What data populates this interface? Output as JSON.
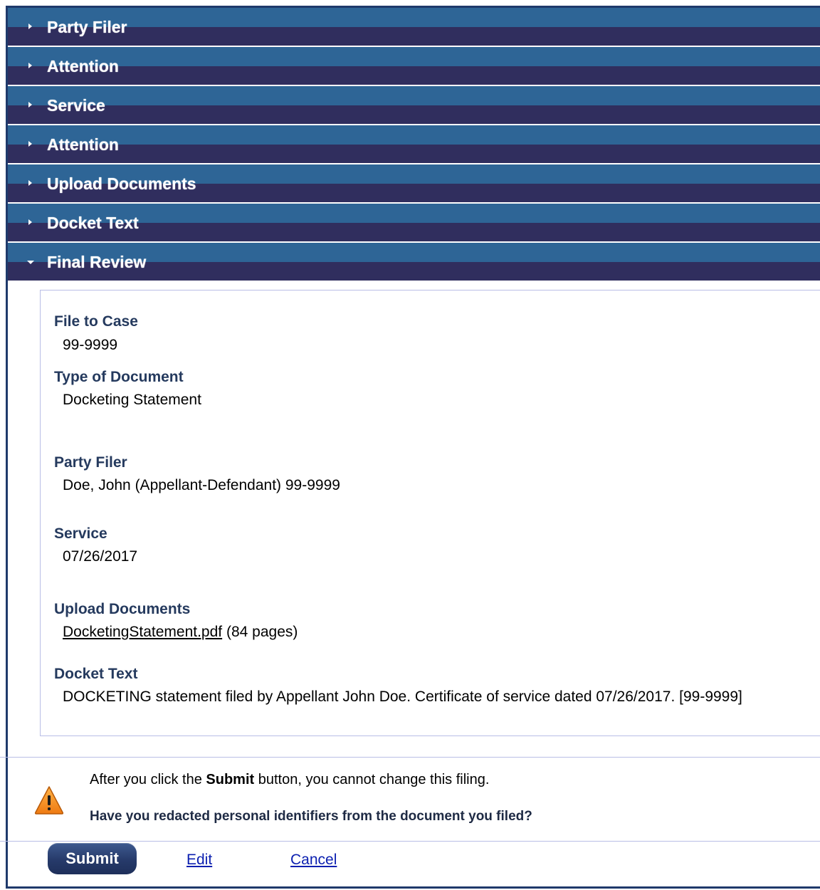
{
  "accordion": [
    {
      "label": "Party Filer",
      "open": false
    },
    {
      "label": "Attention",
      "open": false
    },
    {
      "label": "Service",
      "open": false
    },
    {
      "label": "Attention",
      "open": false
    },
    {
      "label": "Upload Documents",
      "open": false
    },
    {
      "label": "Docket Text",
      "open": false
    },
    {
      "label": "Final Review",
      "open": true
    }
  ],
  "review": {
    "file_to_case": {
      "label": "File to Case",
      "value": "99-9999"
    },
    "type_of_document": {
      "label": "Type of Document",
      "value": "Docketing Statement"
    },
    "party_filer": {
      "label": "Party Filer",
      "value": "Doe, John (Appellant-Defendant) 99-9999"
    },
    "service": {
      "label": "Service",
      "value": "07/26/2017"
    },
    "upload_documents": {
      "label": "Upload Documents",
      "file_name": "DocketingStatement.pdf",
      "pages": "(84 pages)"
    },
    "docket_text": {
      "label": "Docket Text",
      "value": "DOCKETING statement filed by Appellant John Doe. Certificate of service dated 07/26/2017. [99-9999]"
    }
  },
  "warning": {
    "line1_before": "After you click the ",
    "line1_bold": "Submit",
    "line1_after": " button, you cannot change this filing.",
    "question": "Have you redacted personal identifiers from the document you filed?",
    "icon": "warning-triangle-icon",
    "icon_color": "#f28a1c"
  },
  "actions": {
    "submit_label": "Submit",
    "edit_label": "Edit",
    "cancel_label": "Cancel"
  },
  "colors": {
    "header_top": "#2e6596",
    "header_bottom": "#302e5e",
    "frame_border": "#1f3a6b",
    "label_color": "#253a5e",
    "link_color": "#0b1fb0"
  }
}
